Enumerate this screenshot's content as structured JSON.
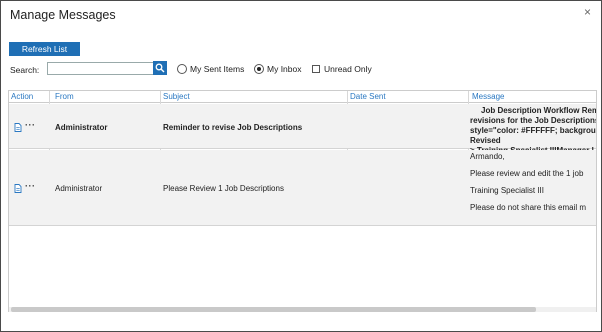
{
  "dialog": {
    "title": "Manage Messages",
    "close": "×"
  },
  "toolbar": {
    "refresh_label": "Refresh List"
  },
  "search": {
    "label": "Search:",
    "value": "",
    "placeholder": ""
  },
  "filters": {
    "my_sent_items": {
      "label": "My Sent Items",
      "selected": false
    },
    "my_inbox": {
      "label": "My Inbox",
      "selected": true
    },
    "unread_only": {
      "label": "Unread Only",
      "checked": false
    }
  },
  "table": {
    "headers": [
      "Action",
      "From",
      "Subject",
      "Date Sent",
      "Message"
    ],
    "rows": [
      {
        "action_icon": "document-icon",
        "action_menu": "···",
        "from": "Administrator",
        "subject": "Reminder to revise Job Descriptions",
        "date_sent": "",
        "message_lines": [
          "Job Description Workflow Rem",
          "revisions for the Job Descriptions",
          "style=\"color: #FFFFFF; background",
          "Revised",
          ">  Training Specialist IIIManager I"
        ],
        "unread": true
      },
      {
        "action_icon": "document-icon",
        "action_menu": "···",
        "from": "Administrator",
        "subject": "Please Review 1 Job Descriptions",
        "date_sent": "",
        "message_lines": [
          "Armando,",
          "Please review and edit the 1 job",
          "Training Specialist III",
          "Please do not share this email m"
        ],
        "unread": false
      }
    ]
  },
  "colors": {
    "accent": "#1f6fb5",
    "header_text": "#2a78c2",
    "row_bg": "#f2f2f2"
  }
}
